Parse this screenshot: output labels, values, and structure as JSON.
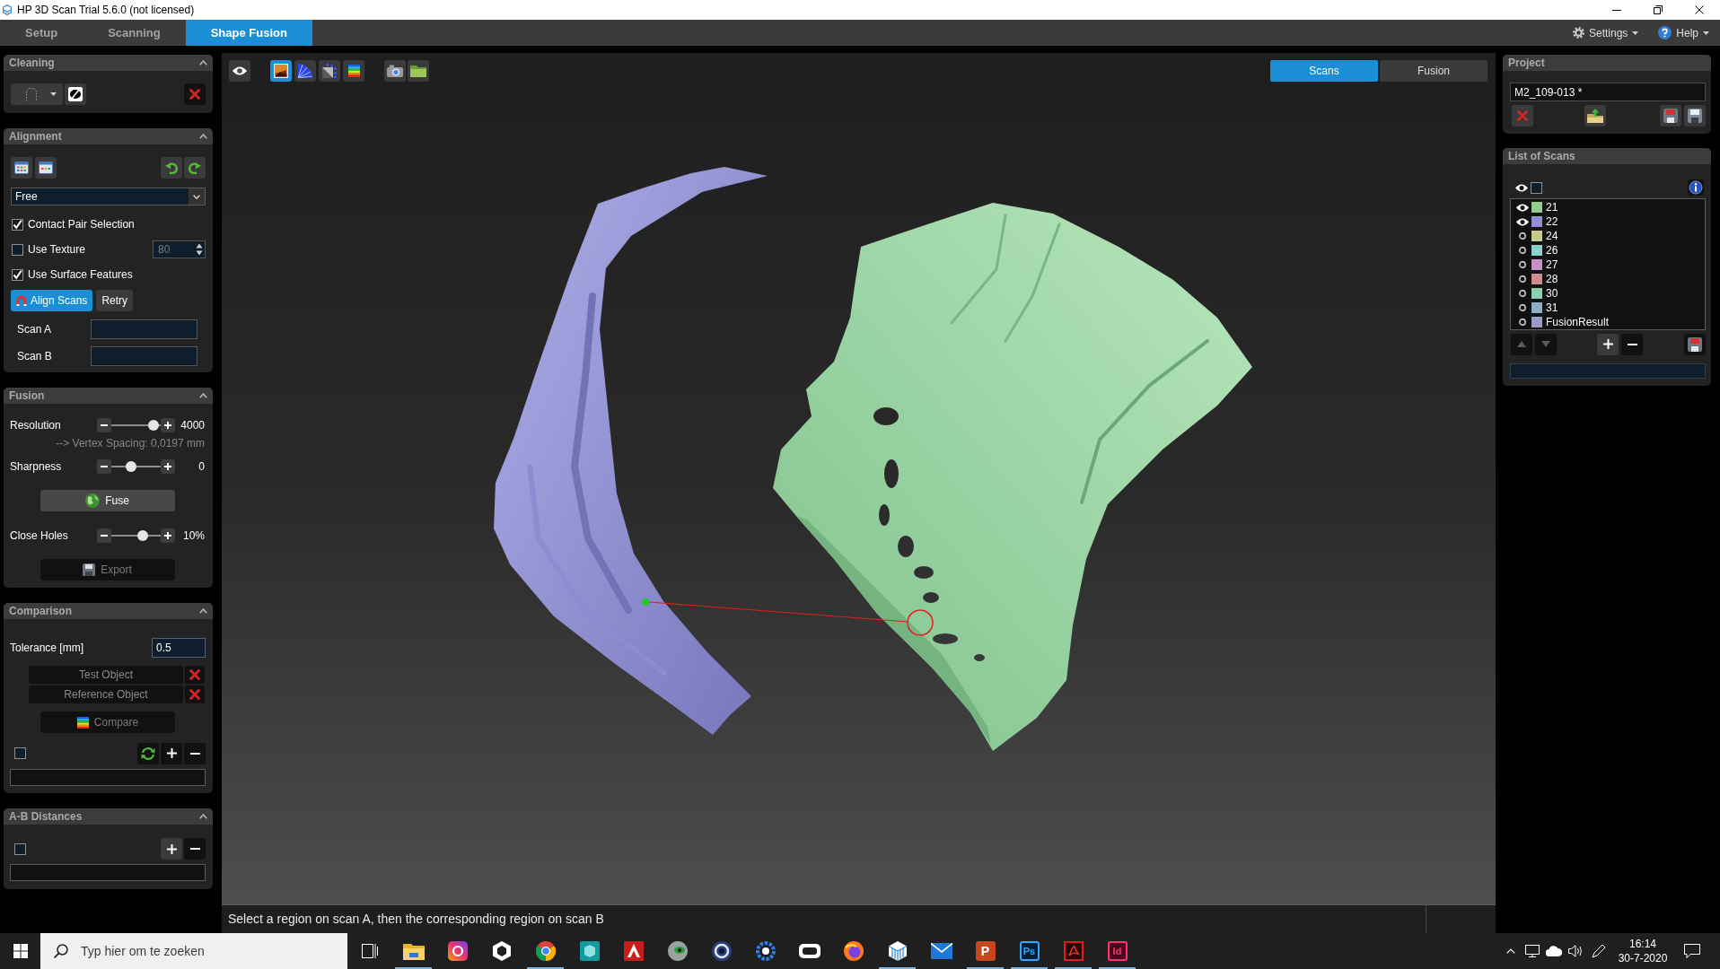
{
  "window": {
    "title": "HP 3D Scan Trial 5.6.0 (not licensed)"
  },
  "tabs": [
    {
      "label": "Setup",
      "selected": false
    },
    {
      "label": "Scanning",
      "selected": false
    },
    {
      "label": "Shape Fusion",
      "selected": true
    }
  ],
  "menu": [
    {
      "kind": "settings",
      "label": "Settings"
    },
    {
      "kind": "help",
      "label": "Help"
    }
  ],
  "left_panel": {
    "cleaning": {
      "title": "Cleaning",
      "expanded": true
    },
    "alignment": {
      "title": "Alignment",
      "expanded": true,
      "mode": "Free",
      "options": [
        {
          "label": "Contact Pair Selection",
          "checked": true
        },
        {
          "label": "Use Texture",
          "checked": false,
          "value": "80"
        },
        {
          "label": "Use Surface Features",
          "checked": true
        }
      ],
      "buttons": [
        {
          "kind": "align",
          "label": "Align Scans",
          "active": true
        },
        {
          "kind": "retry",
          "label": "Retry",
          "active": false
        }
      ],
      "fields": [
        {
          "label": "Scan A"
        },
        {
          "label": "Scan B"
        }
      ]
    },
    "fusion": {
      "title": "Fusion",
      "expanded": true,
      "rows": [
        {
          "kind": "slider",
          "label": "Resolution",
          "level": 0.95,
          "reading": "4000"
        },
        {
          "kind": "note",
          "text": "--> Vertex Spacing: 0,0197 mm"
        },
        {
          "kind": "slider",
          "label": "Sharpness",
          "level": 0.38,
          "reading": "0"
        },
        {
          "kind": "fuse",
          "label": "Fuse",
          "disabled": false
        },
        {
          "kind": "slider",
          "label": "Close Holes",
          "level": 0.67,
          "reading": "10%"
        },
        {
          "kind": "export",
          "label": "Export",
          "disabled": true
        }
      ]
    },
    "comparison": {
      "title": "Comparison",
      "expanded": true,
      "tolerance": {
        "label": "Tolerance [mm]",
        "value": "0.5"
      },
      "objects": [
        {
          "label": "Test Object"
        },
        {
          "label": "Reference Object"
        }
      ],
      "compare_button": {
        "label": "Compare",
        "disabled": true
      },
      "show_all": {
        "checked": false
      }
    },
    "ab_distances": {
      "title": "A-B Distances",
      "expanded": true,
      "show_all": {
        "checked": false
      }
    }
  },
  "view_toolbar": {
    "render_modes": [
      {
        "kind": "texture",
        "selected": true
      },
      {
        "kind": "normals",
        "selected": false
      },
      {
        "kind": "lighting",
        "selected": false
      },
      {
        "kind": "colormap",
        "selected": false
      }
    ]
  },
  "view_tabs": [
    {
      "label": "Scans",
      "selected": true
    },
    {
      "label": "Fusion",
      "selected": false
    }
  ],
  "status_bar": {
    "message": "Select a region on scan A, then the corresponding region on scan B"
  },
  "right_panel": {
    "project": {
      "title": "Project",
      "name": "M2_109-013 *"
    },
    "scans": {
      "title": "List of Scans",
      "show_all": {
        "checked": false
      },
      "items": [
        {
          "name": "21",
          "visible": true,
          "color": "#8fcf8f"
        },
        {
          "name": "22",
          "visible": true,
          "color": "#8f8fcf"
        },
        {
          "name": "24",
          "visible": false,
          "color": "#c8c88f"
        },
        {
          "name": "26",
          "visible": false,
          "color": "#8fcfcf"
        },
        {
          "name": "27",
          "visible": false,
          "color": "#c88fc8"
        },
        {
          "name": "28",
          "visible": false,
          "color": "#c88f8f"
        },
        {
          "name": "30",
          "visible": false,
          "color": "#8fcfaf"
        },
        {
          "name": "31",
          "visible": false,
          "color": "#8fafc8"
        },
        {
          "name": "FusionResult",
          "visible": false,
          "color": "#9a9ad0"
        }
      ]
    }
  },
  "taskbar": {
    "search": {
      "placeholder": "Typ hier om te zoeken"
    },
    "apps": [
      {
        "kind": "folder",
        "running": true
      },
      {
        "kind": "gradient",
        "running": false
      },
      {
        "kind": "hexagon",
        "running": false
      },
      {
        "kind": "wheel",
        "running": true
      },
      {
        "kind": "box",
        "running": false
      },
      {
        "kind": "peak",
        "running": false
      },
      {
        "kind": "eyeball",
        "running": false
      },
      {
        "kind": "orbit",
        "running": false
      },
      {
        "kind": "cog",
        "running": false
      },
      {
        "kind": "visor",
        "running": false
      },
      {
        "kind": "flame",
        "running": false
      },
      {
        "kind": "cube",
        "running": true
      },
      {
        "kind": "mail",
        "running": false
      },
      {
        "kind": "slides",
        "label": "P",
        "running": true
      },
      {
        "kind": "photo",
        "label": "Ps",
        "running": true
      },
      {
        "kind": "pdf",
        "running": true
      },
      {
        "kind": "layout",
        "label": "Id",
        "running": true
      }
    ],
    "time": "16:14",
    "date": "30-7-2020"
  }
}
